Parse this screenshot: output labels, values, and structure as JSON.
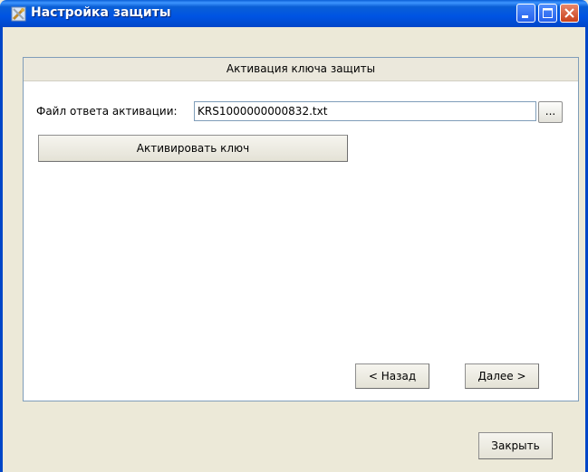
{
  "window": {
    "title": "Настройка защиты",
    "icon": "tools-icon",
    "controls": [
      "minimize-icon",
      "maximize-icon",
      "close-icon"
    ]
  },
  "panel": {
    "header": "Активация ключа защиты",
    "file_label": "Файл ответа активации:",
    "file_value": "KRS1000000000832.txt",
    "browse_label": "...",
    "activate_label": "Активировать ключ",
    "back_label": "< Назад",
    "next_label": "Далее >"
  },
  "footer": {
    "close_label": "Закрыть"
  },
  "colors": {
    "titlebar": "#0054e3",
    "window_bg": "#ece9d8",
    "panel_bg": "#ffffff",
    "panel_header_bg": "#ebe8dc"
  }
}
